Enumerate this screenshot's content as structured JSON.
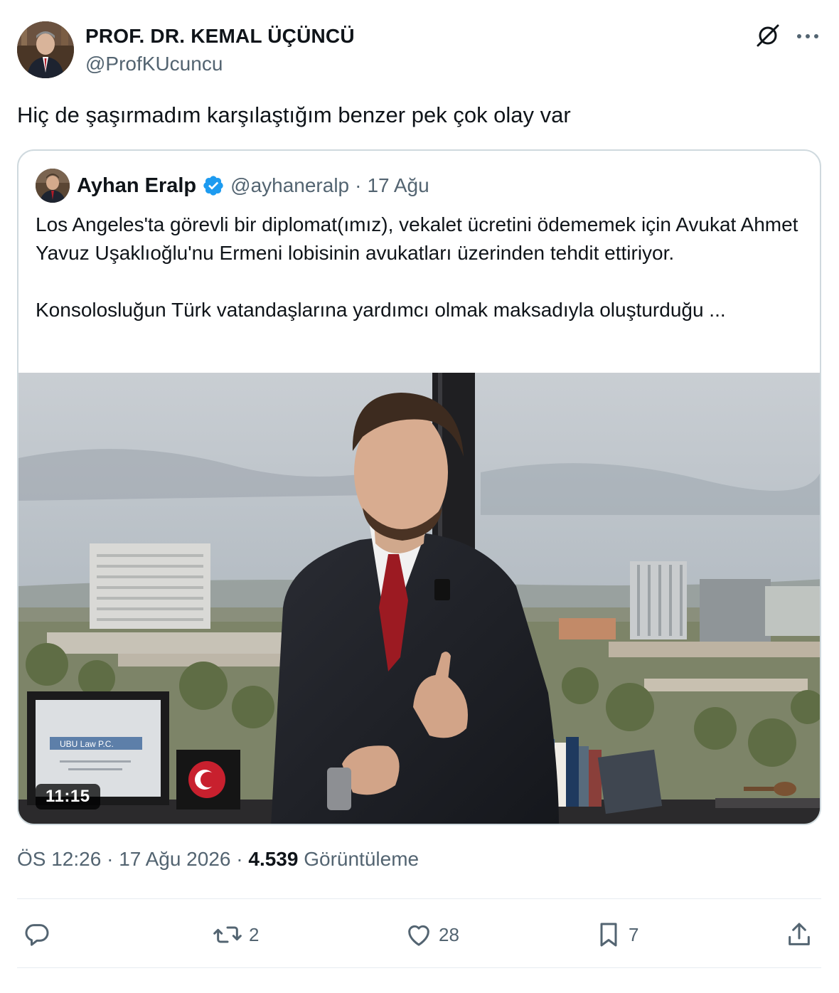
{
  "author": {
    "name": "PROF. DR. KEMAL ÜÇÜNCÜ",
    "handle": "@ProfKUcuncu"
  },
  "tweet": {
    "text": "Hiç de şaşırmadım karşılaştığım benzer pek çok olay var"
  },
  "quoted": {
    "name": "Ayhan Eralp",
    "handle": "@ayhaneralp",
    "separator": "·",
    "date": "17 Ağu",
    "paragraph1": "Los Angeles'ta görevli bir  diplomat(ımız), vekalet ücretini ödememek için Avukat Ahmet Yavuz Uşaklıoğlu'nu Ermeni lobisinin avukatları üzerinden tehdit ettiriyor.",
    "paragraph2": "Konsolosluğun Türk vatandaşlarına yardımcı olmak maksadıyla oluşturduğu ...",
    "video": {
      "duration": "11:15",
      "certificate_text": "UBU Law P.C."
    }
  },
  "meta": {
    "time": "ÖS 12:26",
    "sep1": "·",
    "date": "17 Ağu 2026",
    "sep2": "·",
    "views_count": "4.539",
    "views_label": "Görüntüleme"
  },
  "actions": {
    "reply_count": "",
    "retweet_count": "2",
    "like_count": "28",
    "bookmark_count": "7"
  },
  "colors": {
    "text": "#0f1419",
    "secondary": "#536471",
    "verified": "#1d9bf0",
    "border": "#cfd9de"
  },
  "icons": [
    "grok-icon",
    "more-icon",
    "verified-icon",
    "reply-icon",
    "retweet-icon",
    "like-icon",
    "bookmark-icon",
    "share-icon"
  ]
}
